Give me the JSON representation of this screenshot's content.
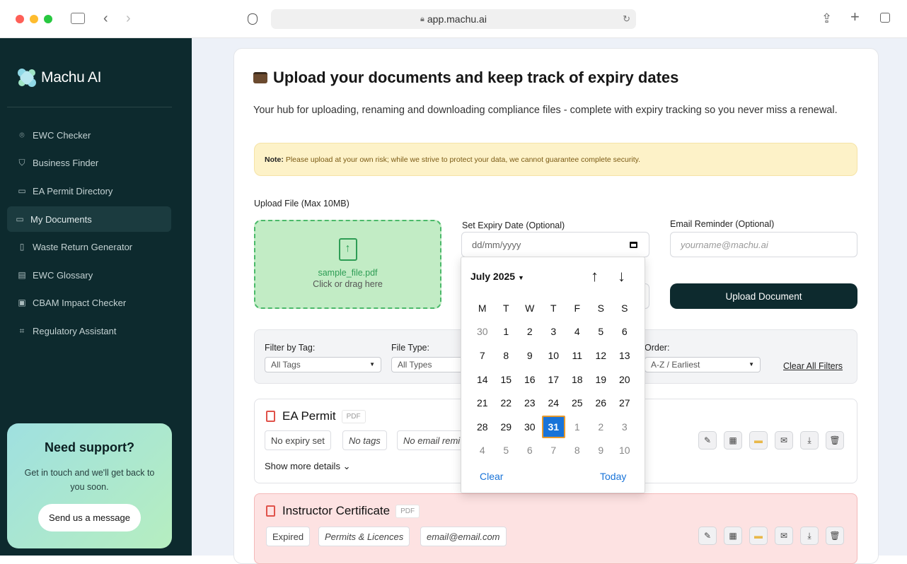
{
  "browser": {
    "url": "app.machu.ai"
  },
  "sidebar": {
    "brand": "Machu AI",
    "items": [
      {
        "label": "EWC Checker",
        "icon": "scan-icon"
      },
      {
        "label": "Business Finder",
        "icon": "handshake-icon"
      },
      {
        "label": "EA Permit Directory",
        "icon": "folder-open-icon"
      },
      {
        "label": "My Documents",
        "icon": "folder-icon",
        "active": true
      },
      {
        "label": "Waste Return Generator",
        "icon": "file-icon"
      },
      {
        "label": "EWC Glossary",
        "icon": "book-icon"
      },
      {
        "label": "CBAM Impact Checker",
        "icon": "monitor-icon"
      },
      {
        "label": "Regulatory Assistant",
        "icon": "chat-icon"
      }
    ],
    "support": {
      "title": "Need support?",
      "text": "Get in touch and we'll get back to you soon.",
      "button": "Send us a message"
    }
  },
  "main": {
    "title": "Upload your documents and keep track of expiry dates",
    "description": "Your hub for uploading, renaming and downloading compliance files - complete with expiry tracking so you never miss a renewal.",
    "note_label": "Note:",
    "note_text": "Please upload at your own risk; while we strive to protect your data, we cannot guarantee complete security.",
    "upload_label": "Upload File (Max 10MB)",
    "file_name": "sample_file.pdf",
    "drop_hint": "Click or drag here",
    "expiry_label": "Set Expiry Date (Optional)",
    "expiry_placeholder": "dd/mm/yyyy",
    "email_label": "Email Reminder (Optional)",
    "email_placeholder": "yourname@machu.ai",
    "upload_button": "Upload Document"
  },
  "filters": {
    "tag_label": "Filter by Tag:",
    "tag_value": "All Tags",
    "type_label": "File Type:",
    "type_value": "All Types",
    "order_label": "Order:",
    "order_value": "A-Z / Earliest",
    "clear": "Clear All Filters"
  },
  "documents": [
    {
      "title": "EA Permit",
      "type": "PDF",
      "expiry": "No expiry set",
      "tags": "No tags",
      "email": "No email remi",
      "more": "Show more details"
    },
    {
      "title": "Instructor Certificate",
      "type": "PDF",
      "expiry": "Expired",
      "tags": "Permits & Licences",
      "email": "email@email.com"
    }
  ],
  "calendar": {
    "month": "July 2025",
    "weekdays": [
      "M",
      "T",
      "W",
      "T",
      "F",
      "S",
      "S"
    ],
    "weeks": [
      [
        "30",
        "1",
        "2",
        "3",
        "4",
        "5",
        "6"
      ],
      [
        "7",
        "8",
        "9",
        "10",
        "11",
        "12",
        "13"
      ],
      [
        "14",
        "15",
        "16",
        "17",
        "18",
        "19",
        "20"
      ],
      [
        "21",
        "22",
        "23",
        "24",
        "25",
        "26",
        "27"
      ],
      [
        "28",
        "29",
        "30",
        "31",
        "1",
        "2",
        "3"
      ],
      [
        "4",
        "5",
        "6",
        "7",
        "8",
        "9",
        "10"
      ]
    ],
    "selected": "31",
    "clear": "Clear",
    "today": "Today"
  },
  "colors": {
    "sidebar": "#0d2a2e",
    "accent": "#1873d8",
    "drop_bg": "#c2ecc5",
    "expired_bg": "#fde2e2"
  }
}
